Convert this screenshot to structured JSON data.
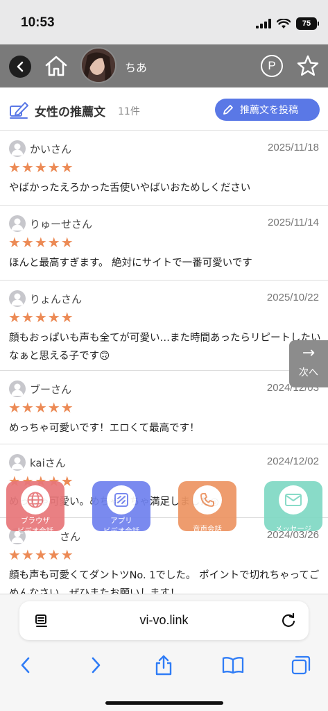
{
  "status_bar": {
    "time": "10:53",
    "battery": "75"
  },
  "profile": {
    "name": "ちあ",
    "p_label": "P"
  },
  "section": {
    "title": "女性の推薦文",
    "count": "11件",
    "post_button": "推薦文を投稿"
  },
  "reviews": [
    {
      "name": "かいさん",
      "date": "2025/11/18",
      "stars": "★★★★★",
      "text": "やばかったえろかった舌使いやばいおためしください"
    },
    {
      "name": "りゅーせさん",
      "date": "2025/11/14",
      "stars": "★★★★★",
      "text": "ほんと最高すぎます。 絶対にサイトで一番可愛いです"
    },
    {
      "name": "りょんさん",
      "date": "2025/10/22",
      "stars": "★★★★★",
      "text": "顔もおっぱいも声も全てが可愛い…また時間あったらリピートしたいなぁと思える子です🙃"
    },
    {
      "name": "ブーさん",
      "date": "2024/12/03",
      "stars": "★★★★★",
      "text": "めっちゃ可愛いです！エロくて最高です！"
    },
    {
      "name": "kaiさん",
      "date": "2024/12/02",
      "stars": "★★★★★",
      "text": "めっちゃ可愛い。めちゃくちゃ満足しました◎"
    },
    {
      "name": "さん",
      "date": "2024/03/26",
      "stars": "★★★★★",
      "text": "顔も声も可愛くてダントツNo. 1でした。 ポイントで切れちゃってごめんなさい、ぜひまたお願いします！"
    }
  ],
  "next_button": {
    "arrow": "→",
    "label": "次へ"
  },
  "fabs": {
    "browser": {
      "line1": "ブラウザ",
      "line2": "ビデオ会話",
      "color": "#e87679"
    },
    "app": {
      "line1": "アプリ",
      "line2": "ビデオ会話",
      "color": "#6f81ee"
    },
    "voice": {
      "label": "音声会話",
      "color": "#ed9462"
    },
    "message": {
      "label": "メッセージ",
      "color": "#7fd9c4"
    }
  },
  "browser": {
    "url": "vi-vo.link"
  },
  "colors": {
    "accent": "#5a78e6",
    "star": "#ec8a55",
    "header_bg": "#7a7a7a"
  }
}
